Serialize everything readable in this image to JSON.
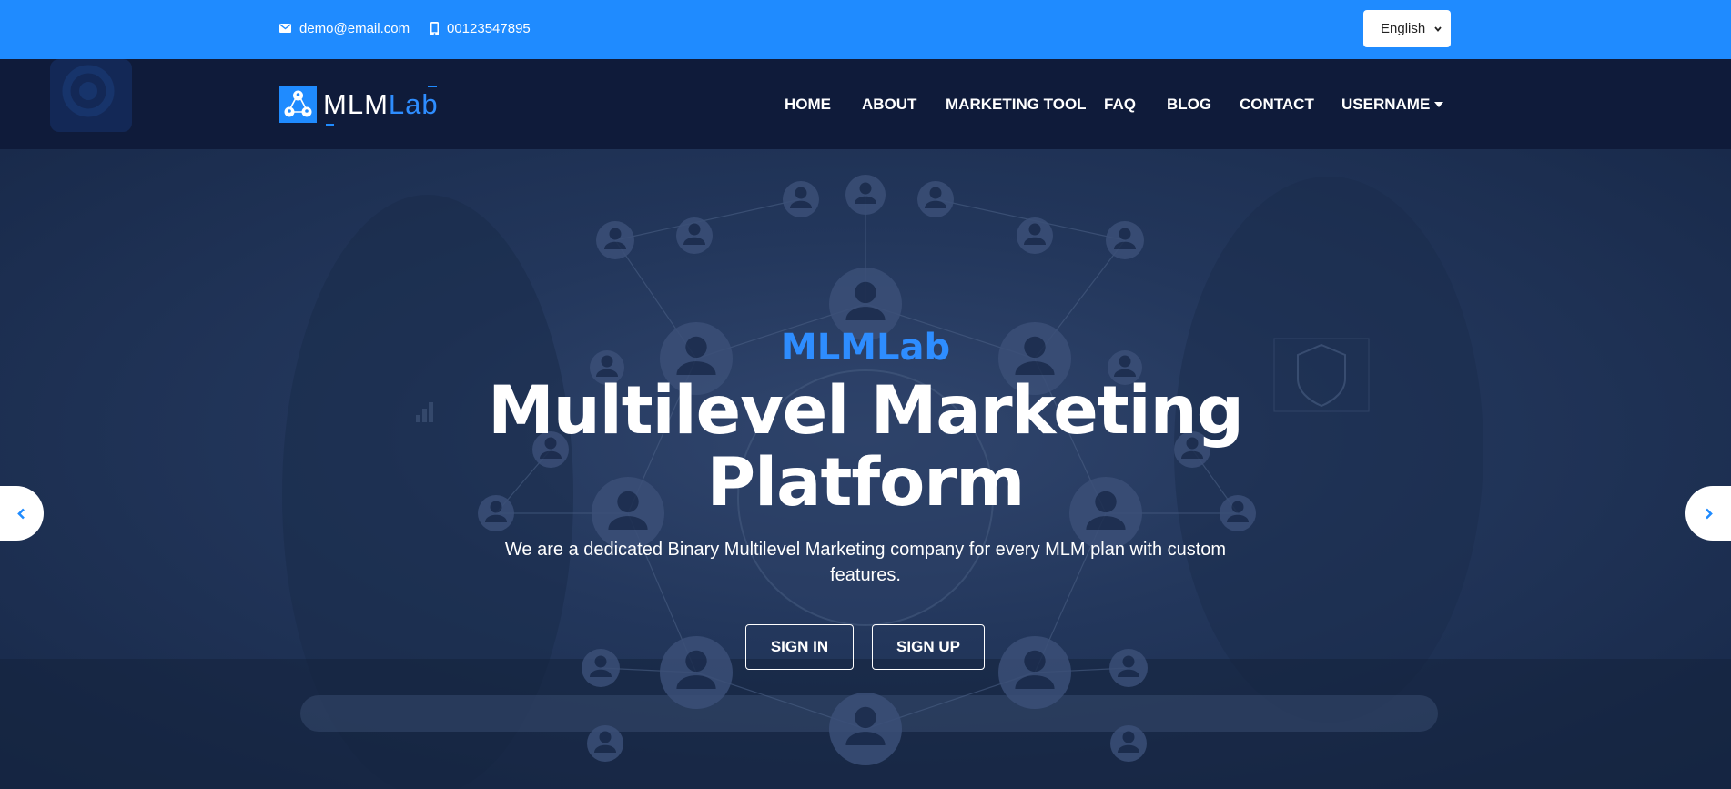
{
  "topbar": {
    "email": "demo@email.com",
    "phone": "00123547895",
    "language": "English"
  },
  "brand": {
    "part1": "MLM",
    "part2": "Lab"
  },
  "nav": {
    "items": [
      "HOME",
      "ABOUT",
      "MARKETING TOOL",
      "FAQ",
      "BLOG",
      "CONTACT"
    ],
    "user": "USERNAME"
  },
  "hero": {
    "kicker": "MLMLab",
    "headline": "Multilevel Marketing Platform",
    "subtitle": "We are a dedicated Binary Multilevel Marketing company for every MLM plan with custom features.",
    "buttons": {
      "signin": "SIGN IN",
      "signup": "SIGN UP"
    }
  },
  "colors": {
    "accent": "#1f8bff",
    "nav_bg": "#0f1b3a",
    "hero_bg": "#23375c"
  },
  "icons": [
    "envelope-icon",
    "mobile-phone-icon",
    "caret-down-icon",
    "chevron-left-icon",
    "chevron-right-icon",
    "network-logo-icon"
  ]
}
